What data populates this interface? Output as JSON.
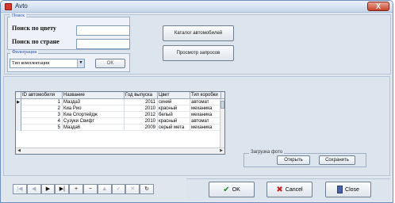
{
  "window": {
    "title": "Avto",
    "close_label": "X"
  },
  "search": {
    "group_label": "Поиск",
    "by_color_label": "Поиск по цвету",
    "by_country_label": "Поиск по стране",
    "by_color_value": "",
    "by_country_value": ""
  },
  "filter": {
    "group_label": "Фильтрация",
    "selected": "Тип комплектации",
    "ok_label": "OK"
  },
  "actions": {
    "catalog_label": "Каталог автомобилей",
    "queries_label": "Просмотр запросов"
  },
  "grid": {
    "columns": [
      "ID автомобиля",
      "Название",
      "Год выпуска",
      "Цвет",
      "Тип коробки"
    ],
    "rows": [
      [
        "1",
        "Мазда3",
        "2011",
        "синий",
        "автомат"
      ],
      [
        "2",
        "Киа Рио",
        "2010",
        "красный",
        "механика"
      ],
      [
        "3",
        "Киа Спортейдж",
        "2012",
        "белый",
        "механика"
      ],
      [
        "4",
        "Сузуки Свифт",
        "2010",
        "красный",
        "автомат"
      ],
      [
        "5",
        "Мазда6",
        "2009",
        "серый мета",
        "механика"
      ]
    ]
  },
  "photo": {
    "group_label": "Загрузка фото",
    "open_label": "Открыть",
    "save_label": "Сохранить"
  },
  "navigator": [
    "|◀",
    "◀",
    "▶",
    "▶|",
    "+",
    "−",
    "▲",
    "✓",
    "✕",
    "↻"
  ],
  "footer": {
    "ok_label": "OK",
    "cancel_label": "Cancel",
    "close_label": "Close"
  }
}
